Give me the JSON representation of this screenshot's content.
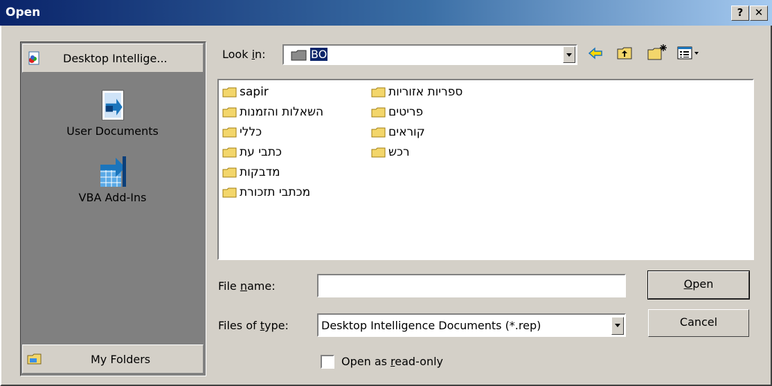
{
  "window": {
    "title": "Open",
    "help_label": "?",
    "close_label": "✕"
  },
  "places": {
    "top_label": "Desktop Intellige...",
    "items": [
      {
        "label": "User Documents"
      },
      {
        "label": "VBA Add-Ins"
      }
    ],
    "bottom_label": "My Folders"
  },
  "lookin": {
    "label_pre": "Look ",
    "label_u": "i",
    "label_post": "n:",
    "value": "BO"
  },
  "toolbar": {
    "icons": [
      "back-icon",
      "up-folder-icon",
      "new-folder-icon",
      "views-icon"
    ]
  },
  "files": {
    "col1": [
      "sapir",
      "השאלות והזמנות",
      "כללי",
      "כתבי עת",
      "מדבקות",
      "מכתבי תזכורת"
    ],
    "col2": [
      "ספריות אזוריות",
      "פריטים",
      "קוראים",
      "רכש"
    ]
  },
  "filename": {
    "label_pre": "File ",
    "label_u": "n",
    "label_post": "ame:",
    "value": ""
  },
  "filetype": {
    "label_pre": "Files of ",
    "label_u": "t",
    "label_post": "ype:",
    "value": "Desktop Intelligence Documents (*.rep)"
  },
  "buttons": {
    "open_u": "O",
    "open_rest": "pen",
    "cancel": "Cancel"
  },
  "readonly": {
    "label_pre": "Open as ",
    "label_u": "r",
    "label_post": "ead-only",
    "checked": false
  }
}
